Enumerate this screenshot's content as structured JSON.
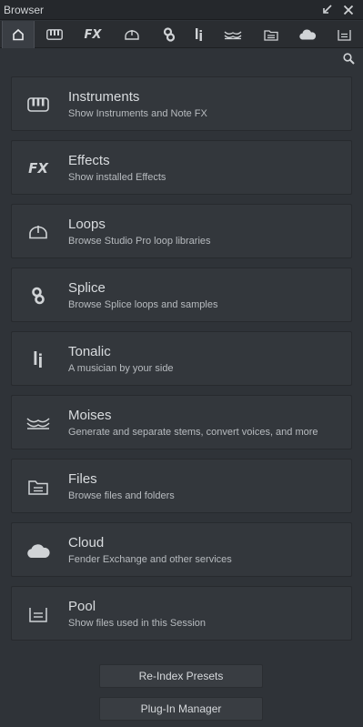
{
  "window": {
    "title": "Browser"
  },
  "tabs": [
    {
      "id": "home",
      "icon": "home-icon"
    },
    {
      "id": "instruments",
      "icon": "piano-icon"
    },
    {
      "id": "effects",
      "icon": "fx-icon"
    },
    {
      "id": "loops",
      "icon": "loop-icon"
    },
    {
      "id": "splice",
      "icon": "splice-icon"
    },
    {
      "id": "tonalic",
      "icon": "tonalic-icon"
    },
    {
      "id": "moises",
      "icon": "moises-icon"
    },
    {
      "id": "files",
      "icon": "folder-icon"
    },
    {
      "id": "cloud",
      "icon": "cloud-icon"
    },
    {
      "id": "pool",
      "icon": "pool-icon"
    }
  ],
  "fx_glyph": "FX",
  "categories": [
    {
      "title": "Instruments",
      "description": "Show Instruments and Note FX",
      "icon": "piano-icon"
    },
    {
      "title": "Effects",
      "description": "Show installed Effects",
      "icon": "fx-icon"
    },
    {
      "title": "Loops",
      "description": "Browse Studio Pro loop libraries",
      "icon": "loop-icon"
    },
    {
      "title": "Splice",
      "description": "Browse Splice loops and samples",
      "icon": "splice-icon"
    },
    {
      "title": "Tonalic",
      "description": "A musician by your side",
      "icon": "tonalic-icon"
    },
    {
      "title": "Moises",
      "description": "Generate and separate stems, convert voices, and more",
      "icon": "moises-icon"
    },
    {
      "title": "Files",
      "description": "Browse files and folders",
      "icon": "folder-icon"
    },
    {
      "title": "Cloud",
      "description": "Fender Exchange and other services",
      "icon": "cloud-icon"
    },
    {
      "title": "Pool",
      "description": "Show files used in this Session",
      "icon": "pool-icon"
    }
  ],
  "buttons": {
    "reindex": "Re-Index Presets",
    "plugin_manager": "Plug-In Manager"
  },
  "colors": {
    "background": "#2f3338",
    "card": "#33373c",
    "text": "#d6d9dc",
    "icon": "#d0d3d6"
  }
}
